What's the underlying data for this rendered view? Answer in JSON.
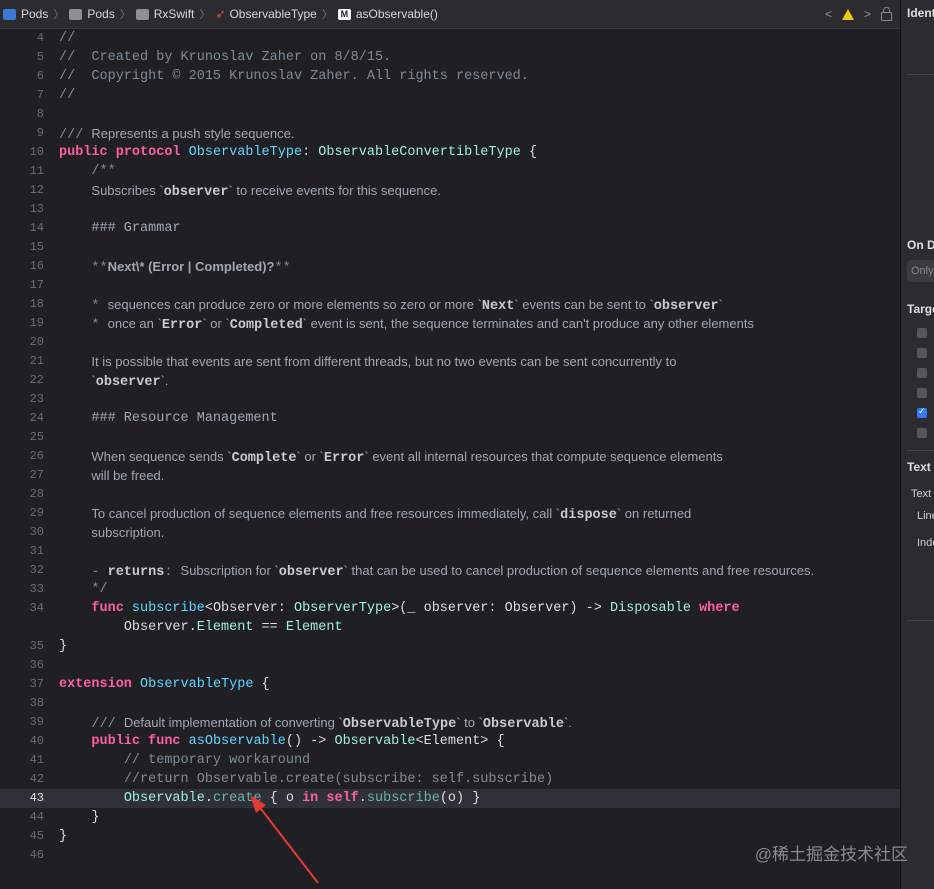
{
  "breadcrumb": [
    "Pods",
    "Pods",
    "RxSwift",
    "ObservableType",
    "asObservable()"
  ],
  "inspector": {
    "title": "Ident",
    "on_demand": "On D",
    "only": "Only",
    "target": "Targe",
    "text_header": "Text",
    "text_row": "Text",
    "line_row": "Line",
    "indent_row": "Inde"
  },
  "watermark": "@稀土掘金技术社区",
  "code": {
    "l4": "//",
    "l5": "//  Created by Krunoslav Zaher on 8/8/15.",
    "l6": "//  Copyright © 2015 Krunoslav Zaher. All rights reserved.",
    "l7": "//",
    "l9a": "/// ",
    "l9b": "Represents a push style sequence.",
    "l10a": "public",
    "l10b": "protocol",
    "l10c": "ObservableType",
    "l10d": "ObservableConvertibleType",
    "l11": "/**",
    "l12a": "Subscribes `",
    "l12b": "observer",
    "l12c": "` to receive events for this sequence.",
    "l14": "### Grammar",
    "l16a": "**",
    "l16b": "Next\\* (Error | Completed)?",
    "l16c": "**",
    "l18a": "* ",
    "l18b": "sequences can produce zero or more elements so zero or more `",
    "l18c": "Next",
    "l18d": "` events can be sent to `",
    "l18e": "observer",
    "l18f": "`",
    "l19a": "* ",
    "l19b": "once an `",
    "l19c": "Error",
    "l19d": "` or `",
    "l19e": "Completed",
    "l19f": "` event is sent, the sequence terminates and can't produce any other elements",
    "l21": "It is possible that events are sent from different threads, but no two events can be sent concurrently to",
    "l22a": "`",
    "l22b": "observer",
    "l22c": "`.",
    "l24": "### Resource Management",
    "l26a": "When sequence sends `",
    "l26b": "Complete",
    "l26c": "` or `",
    "l26d": "Error",
    "l26e": "` event all internal resources that compute sequence elements",
    "l27": "will be freed.",
    "l29a": "To cancel production of sequence elements and free resources immediately, call `",
    "l29b": "dispose",
    "l29c": "` on returned",
    "l30": "subscription.",
    "l32a": "- ",
    "l32b": "returns",
    "l32c": ": ",
    "l32d": "Subscription for `",
    "l32e": "observer",
    "l32f": "` that can be used to cancel production of sequence elements and free resources.",
    "l33": "*/",
    "l34a": "func",
    "l34b": "subscribe",
    "l34c": "<Observer: ",
    "l34d": "ObserverType",
    "l34e": ">(_ observer: Observer) -> ",
    "l34f": "Disposable",
    "l34g": "where",
    "l34h": "Observer.",
    "l34i": "Element",
    "l34j": " == ",
    "l34k": "Element",
    "l35": "}",
    "l37a": "extension",
    "l37b": "ObservableType",
    "l37c": " {",
    "l39a": "/// ",
    "l39b": "Default implementation of converting `",
    "l39c": "ObservableType",
    "l39d": "` to `",
    "l39e": "Observable",
    "l39f": "`.",
    "l40a": "public",
    "l40b": "func",
    "l40c": "asObservable",
    "l40d": "() -> ",
    "l40e": "Observable",
    "l40f": "<Element> {",
    "l41": "// temporary workaround",
    "l42": "//return Observable.create(subscribe: self.subscribe)",
    "l43a": "Observable",
    "l43b": ".",
    "l43c": "create",
    "l43d": " { o ",
    "l43e": "in",
    "l43f": "self",
    "l43g": ".",
    "l43h": "subscribe",
    "l43i": "(o) }",
    "l44": "}",
    "l45": "}"
  },
  "line_numbers": [
    "4",
    "5",
    "6",
    "7",
    "8",
    "9",
    "10",
    "11",
    "12",
    "13",
    "14",
    "15",
    "16",
    "17",
    "18",
    "19",
    "20",
    "21",
    "22",
    "23",
    "24",
    "25",
    "26",
    "27",
    "28",
    "29",
    "30",
    "31",
    "32",
    "33",
    "34",
    "35",
    "36",
    "37",
    "38",
    "39",
    "40",
    "41",
    "42",
    "43",
    "44",
    "45",
    "46"
  ]
}
